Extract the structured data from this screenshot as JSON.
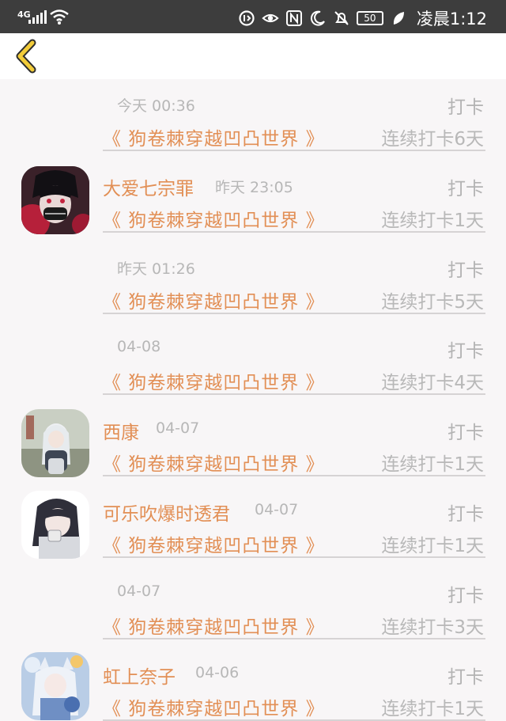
{
  "status_bar": {
    "network": "4G",
    "battery": "50",
    "time": "凌晨1:12"
  },
  "nav": {
    "back_icon": "chevron-left-icon",
    "accent": "#f2cc3a"
  },
  "colors": {
    "accent": "#e28f55",
    "muted": "#b7b7b7",
    "background": "#f8f6f7"
  },
  "rows": [
    {
      "name": "",
      "time": "今天 00:36",
      "action": "打卡",
      "book": "《 狗卷棘穿越凹凸世界 》",
      "streak": "连续打卡6天",
      "avatar": false
    },
    {
      "name": "大爱七宗罪",
      "time": "昨天 23:05",
      "action": "打卡",
      "book": "《 狗卷棘穿越凹凸世界 》",
      "streak": "连续打卡1天",
      "avatar": true
    },
    {
      "name": "",
      "time": "昨天 01:26",
      "action": "打卡",
      "book": "《 狗卷棘穿越凹凸世界 》",
      "streak": "连续打卡5天",
      "avatar": false
    },
    {
      "name": "",
      "time": "04-08",
      "action": "打卡",
      "book": "《 狗卷棘穿越凹凸世界 》",
      "streak": "连续打卡4天",
      "avatar": false
    },
    {
      "name": "西康",
      "time": "04-07",
      "action": "打卡",
      "book": "《 狗卷棘穿越凹凸世界 》",
      "streak": "连续打卡1天",
      "avatar": true
    },
    {
      "name": "可乐吹爆时透君",
      "time": "04-07",
      "action": "打卡",
      "book": "《 狗卷棘穿越凹凸世界 》",
      "streak": "连续打卡1天",
      "avatar": true
    },
    {
      "name": "",
      "time": "04-07",
      "action": "打卡",
      "book": "《 狗卷棘穿越凹凸世界 》",
      "streak": "连续打卡3天",
      "avatar": false
    },
    {
      "name": "虹上奈子",
      "time": "04-06",
      "action": "打卡",
      "book": "《 狗卷棘穿越凹凸世界 》",
      "streak": "连续打卡1天",
      "avatar": true
    }
  ]
}
